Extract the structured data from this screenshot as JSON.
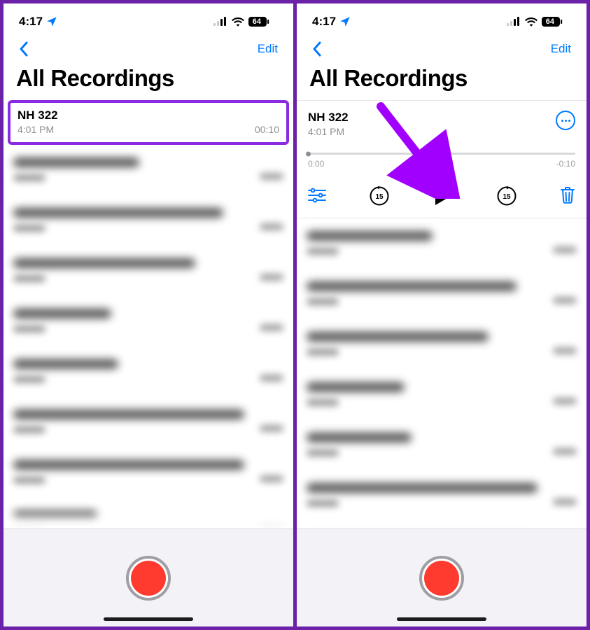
{
  "colors": {
    "accent": "#007aff",
    "highlight_border": "#8a2be2",
    "record": "#ff3b30"
  },
  "annotation": {
    "purpose": "arrow-pointing-to-play-button"
  },
  "left": {
    "status": {
      "time": "4:17",
      "battery": "64"
    },
    "nav": {
      "edit_label": "Edit"
    },
    "title": "All Recordings",
    "recording": {
      "name": "NH 322",
      "time": "4:01 PM",
      "duration": "00:10"
    }
  },
  "right": {
    "status": {
      "time": "4:17",
      "battery": "64"
    },
    "nav": {
      "edit_label": "Edit"
    },
    "title": "All Recordings",
    "player": {
      "name": "NH 322",
      "time": "4:01 PM",
      "elapsed": "0:00",
      "remaining": "-0:10",
      "options_icon": "more-options-icon",
      "settings_icon": "playback-settings-icon",
      "skip_back_icon": "skip-back-15-icon",
      "play_icon": "play-icon",
      "skip_fwd_icon": "skip-forward-15-icon",
      "delete_icon": "trash-icon"
    }
  }
}
